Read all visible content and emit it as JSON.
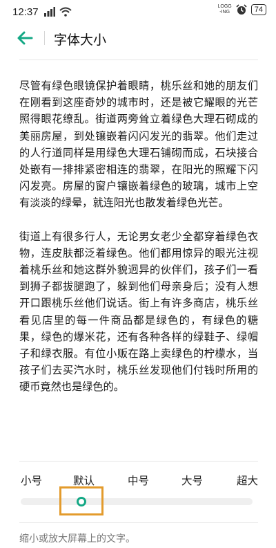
{
  "status_bar": {
    "time": "12:37",
    "logging_line1": "LOGG",
    "logging_line2": "-ING",
    "battery": "74"
  },
  "header": {
    "title": "字体大小"
  },
  "article": {
    "paragraphs": [
      "尽管有绿色眼镜保护着眼睛，桃乐丝和她的朋友们在刚看到这座奇妙的城市时，还是被它耀眼的光芒照得眼花缭乱。街道两旁耸立着绿色大理石砌成的美丽房屋，到处镶嵌着闪闪发光的翡翠。他们走过的人行道同样是用绿色大理石铺砌而成，石块接合处嵌有一排排紧密相连的翡翠，在阳光的照耀下闪闪发亮。房屋的窗户镶嵌着绿色的玻璃，城市上空有淡淡的绿晕，就连阳光也散发着绿色光芒。",
      "街道上有很多行人，无论男女老少全都穿着绿色衣物，连皮肤都泛着绿色。他们都用惊异的眼光注视着桃乐丝和她这群外貌迥异的伙伴们，孩子们一看到狮子都拔腿跑了，躲到他们母亲身后；没有人想开口跟桃乐丝他们说话。街上有许多商店，桃乐丝看见店里的每一件商品都是绿色的，有绿色的糖果，绿色的爆米花，还有各种各样的绿鞋子、绿帽子和绿衣服。有位小贩在路上卖绿色的柠檬水，当孩子们去买汽水时，桃乐丝发现他们付钱时所用的硬币竟然也是绿色的。"
    ]
  },
  "font_size": {
    "options": [
      "小号",
      "默认",
      "中号",
      "大号",
      "超大"
    ],
    "selected": "默认",
    "helper_text": "缩小或放大屏幕上的文字。"
  },
  "colors": {
    "accent": "#14a885",
    "highlight": "#e39b2c"
  }
}
